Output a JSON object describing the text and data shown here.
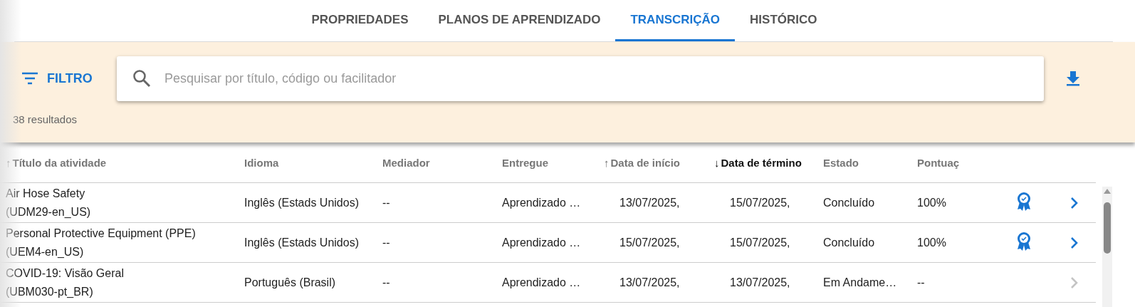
{
  "tabs": [
    {
      "label": "PROPRIEDADES",
      "selected": false
    },
    {
      "label": "PLANOS DE APRENDIZADO",
      "selected": false
    },
    {
      "label": "TRANSCRIÇÃO",
      "selected": true
    },
    {
      "label": "HISTÓRICO",
      "selected": false
    }
  ],
  "filter": {
    "label": "FILTRO"
  },
  "search": {
    "placeholder": "Pesquisar por título, código ou facilitador"
  },
  "results_count": "38 resultados",
  "table": {
    "columns": [
      {
        "label": "Título da atividade",
        "sort_arrow": "↑",
        "selected": false
      },
      {
        "label": "Idioma",
        "selected": false
      },
      {
        "label": "Mediador",
        "selected": false
      },
      {
        "label": "Entregue",
        "selected": false
      },
      {
        "label": "Data de início",
        "sort_arrow": "↑",
        "selected": false
      },
      {
        "label": "Data de término",
        "sort_arrow": "↓",
        "selected": true
      },
      {
        "label": "Estado",
        "selected": false
      },
      {
        "label": "Pontuaç",
        "selected": false
      }
    ],
    "rows": [
      {
        "title": "Air Hose Safety",
        "code": "(UDM29-en_US)",
        "language": "Inglês (Estads Unidos)",
        "mediator": "--",
        "delivered": "Aprendizado …",
        "start": "13/07/2025,",
        "end": "15/07/2025,",
        "status": "Concluído",
        "score": "100%",
        "certificate": true,
        "disabled": false
      },
      {
        "title": "Personal Protective Equipment (PPE)",
        "code": "(UEM4-en_US)",
        "language": "Inglês (Estads Unidos)",
        "mediator": "--",
        "delivered": "Aprendizado …",
        "start": "15/07/2025,",
        "end": "15/07/2025,",
        "status": "Concluído",
        "score": "100%",
        "certificate": true,
        "disabled": false
      },
      {
        "title": "COVID-19: Visão Geral",
        "code": "(UBM030-pt_BR)",
        "language": "Português (Brasil)",
        "mediator": "--",
        "delivered": "Aprendizado …",
        "start": "13/07/2025,",
        "end": "13/07/2025,",
        "status": "Em Andame…",
        "score": "--",
        "certificate": false,
        "disabled": true
      }
    ]
  }
}
